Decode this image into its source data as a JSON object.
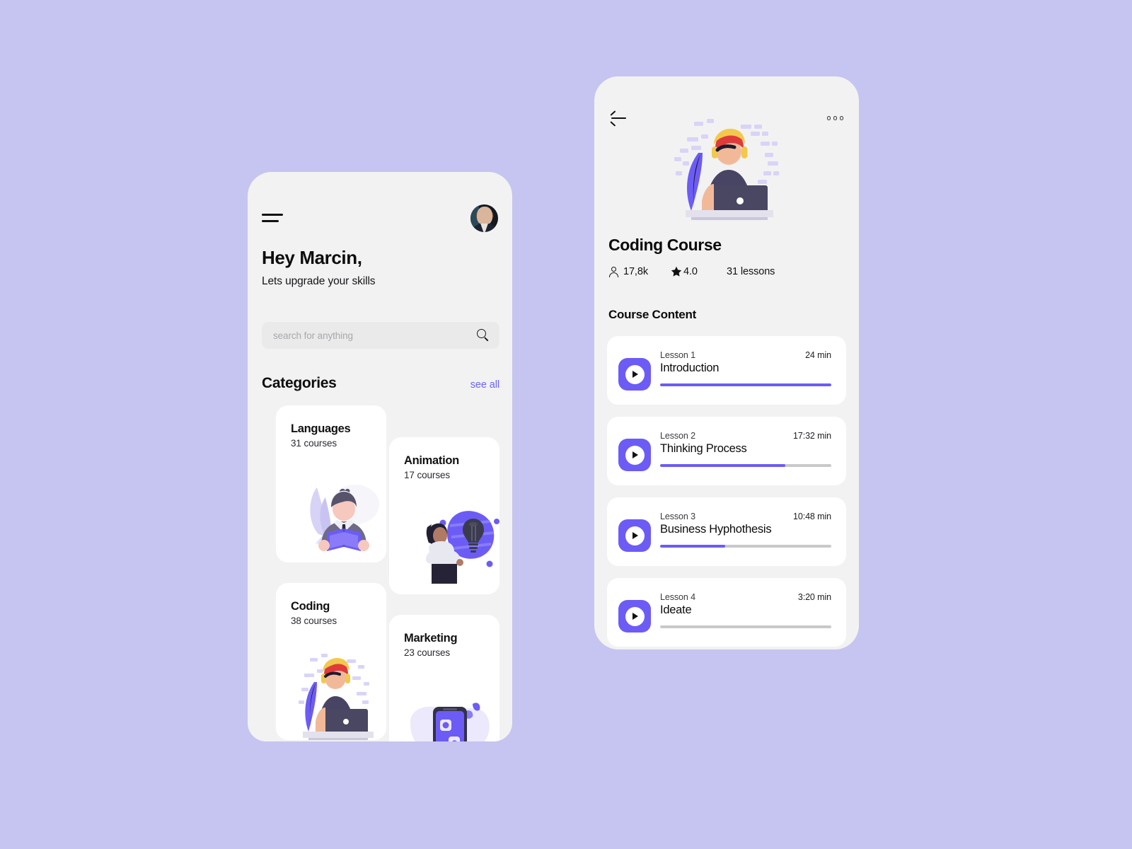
{
  "home": {
    "menu_icon": "hamburger-icon",
    "avatar_alt": "user-avatar",
    "greeting": "Hey Marcin,",
    "subgreeting": "Lets upgrade your skills",
    "search": {
      "placeholder": "search for anything",
      "icon": "search-icon"
    },
    "categories_title": "Categories",
    "see_all_label": "see all",
    "categories": [
      {
        "title": "Languages",
        "courses": "31 courses",
        "illustration": "man-reading-book"
      },
      {
        "title": "Animation",
        "courses": "17 courses",
        "illustration": "woman-with-lightbulb"
      },
      {
        "title": "Coding",
        "courses": "38 courses",
        "illustration": "developer-at-laptop"
      },
      {
        "title": "Marketing",
        "courses": "23 courses",
        "illustration": "smartphone-social-apps"
      }
    ]
  },
  "course": {
    "back_icon": "back-arrow-icon",
    "more_icon": "more-options-icon",
    "hero_illustration": "developer-at-laptop",
    "title": "Coding Course",
    "stats": {
      "students_icon": "person-icon",
      "students": "17,8k",
      "rating_icon": "star-icon",
      "rating": "4.0",
      "lessons": "31 lessons"
    },
    "content_title": "Course Content",
    "lessons": [
      {
        "number": "Lesson 1",
        "name": "Introduction",
        "duration": "24 min",
        "progress": 100
      },
      {
        "number": "Lesson 2",
        "name": "Thinking Process",
        "duration": "17:32 min",
        "progress": 73
      },
      {
        "number": "Lesson 3",
        "name": "Business Hyphothesis",
        "duration": "10:48 min",
        "progress": 38
      },
      {
        "number": "Lesson 4",
        "name": "Ideate",
        "duration": "3:20 min",
        "progress": 0
      }
    ]
  },
  "colors": {
    "page_background": "#C6C4F0",
    "screen_background": "#F2F2F2",
    "card": "#FFFFFF",
    "accent": "#6C5CF5",
    "link": "#6C63FF",
    "track": "#C9C9C9",
    "text": "#0B0B0B",
    "muted": "#A8A8AD"
  }
}
